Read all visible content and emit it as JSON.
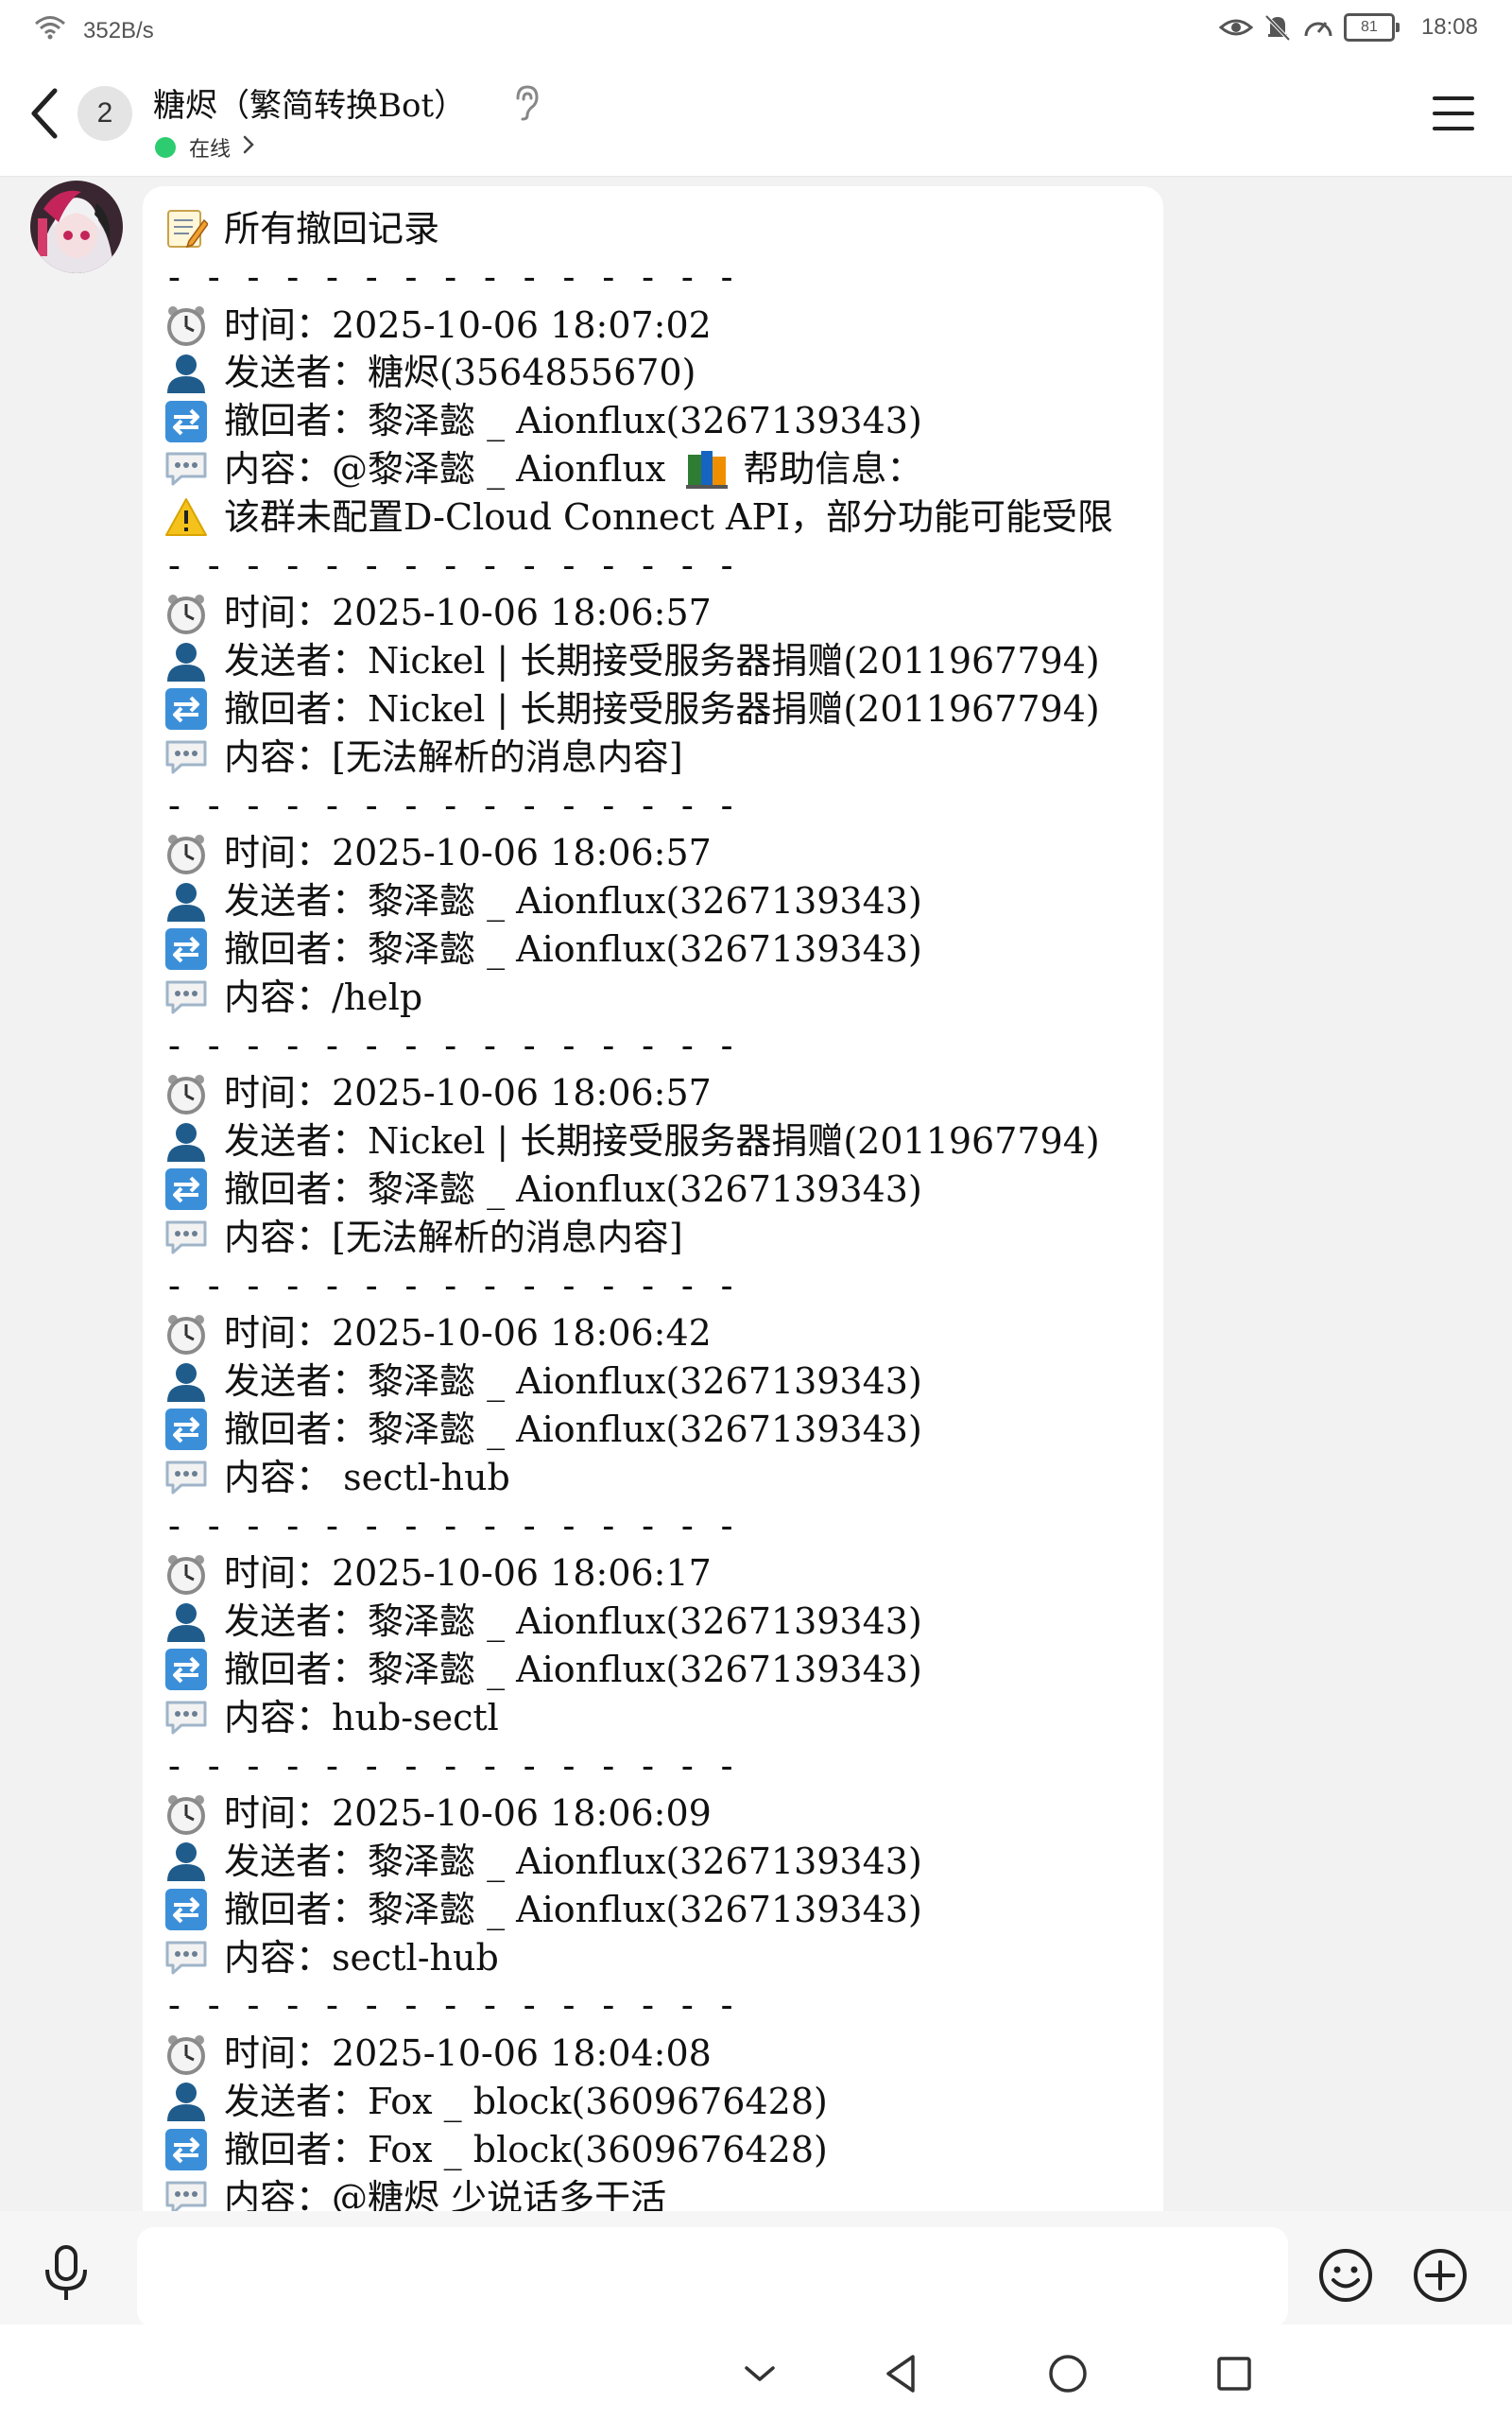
{
  "status_bar": {
    "network_speed": "352B/s",
    "battery": "81",
    "time": "18:08"
  },
  "header": {
    "unread_count": "2",
    "title": "糖烬（繁简转换Bot）",
    "online_status": "在线"
  },
  "message": {
    "heading": "所有撤回记录",
    "separator": "- - - - - - - - - - - - - - -",
    "records": [
      {
        "time": "时间：2025-10-06 18:07:02",
        "sender": "发送者：糖烬(3564855670)",
        "recaller": "撤回者：黎泽懿 _ Aionflux(3267139343)",
        "content": "内容：@黎泽懿 _ Aionflux",
        "content_suffix": "帮助信息：",
        "warning": "该群未配置D-Cloud Connect API，部分功能可能受限"
      },
      {
        "time": "时间：2025-10-06 18:06:57",
        "sender": "发送者：Nickel | 长期接受服务器捐赠(2011967794)",
        "recaller": "撤回者：Nickel | 长期接受服务器捐赠(2011967794)",
        "content": "内容：[无法解析的消息内容]"
      },
      {
        "time": "时间：2025-10-06 18:06:57",
        "sender": "发送者：黎泽懿 _ Aionflux(3267139343)",
        "recaller": "撤回者：黎泽懿 _ Aionflux(3267139343)",
        "content": "内容：/help"
      },
      {
        "time": "时间：2025-10-06 18:06:57",
        "sender": "发送者：Nickel | 长期接受服务器捐赠(2011967794)",
        "recaller": "撤回者：黎泽懿 _ Aionflux(3267139343)",
        "content": "内容：[无法解析的消息内容]"
      },
      {
        "time": "时间：2025-10-06 18:06:42",
        "sender": "发送者：黎泽懿 _ Aionflux(3267139343)",
        "recaller": "撤回者：黎泽懿 _ Aionflux(3267139343)",
        "content": "内容：  sectl-hub"
      },
      {
        "time": "时间：2025-10-06 18:06:17",
        "sender": "发送者：黎泽懿 _ Aionflux(3267139343)",
        "recaller": "撤回者：黎泽懿 _ Aionflux(3267139343)",
        "content": "内容：hub-sectl"
      },
      {
        "time": "时间：2025-10-06 18:06:09",
        "sender": "发送者：黎泽懿 _ Aionflux(3267139343)",
        "recaller": "撤回者：黎泽懿 _ Aionflux(3267139343)",
        "content": "内容：sectl-hub"
      },
      {
        "time": "时间：2025-10-06 18:04:08",
        "sender": "发送者：Fox _ block(3609676428)",
        "recaller": "撤回者：Fox _ block(3609676428)",
        "content": "内容：@糖烬 少说话多干活"
      }
    ]
  },
  "input": {
    "placeholder": ""
  },
  "colors": {
    "online": "#2ecc71",
    "bubble": "#ffffff",
    "background": "#f2f2f2"
  }
}
